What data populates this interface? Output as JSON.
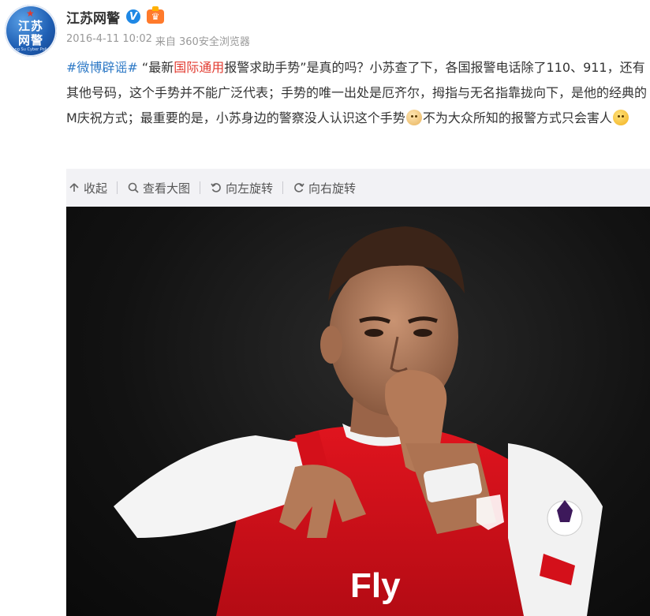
{
  "user": {
    "name": "江苏网警",
    "avatar_text_line1": "江苏",
    "avatar_text_line2": "网警",
    "avatar_subtext": "Jiang Su Cyber Police",
    "verified_icon": "v-verified-icon",
    "member_icon": "crown-badge-icon"
  },
  "meta": {
    "time": "2016-4-11 10:02",
    "source": "来自 360安全浏览器"
  },
  "post": {
    "hashtag": "#微博辟谣#",
    "text_1": " “最新",
    "text_red": "国际通用",
    "text_2": "报警求助手势”是真的吗？小苏查了下，各国报警电话除了110、911，还有其他号码，这个手势并不能广泛代表；手势的唯一出处是厄齐尔，拇指与无名指靠拢向下，是他的经典的M庆祝方式；最重要的是，小苏身边的警察没人认识这个手势",
    "text_3": "不为大众所知的报警方式只会害人"
  },
  "toolbar": {
    "collapse": "收起",
    "view_large": "查看大图",
    "rotate_left": "向左旋转",
    "rotate_right": "向右旋转"
  },
  "photo": {
    "jersey_text": "Fly"
  },
  "colors": {
    "hashtag": "#2f7ac6",
    "highlight": "#e23b30",
    "toolbar_bg": "#f2f2f5",
    "jersey_red": "#d4101a"
  }
}
